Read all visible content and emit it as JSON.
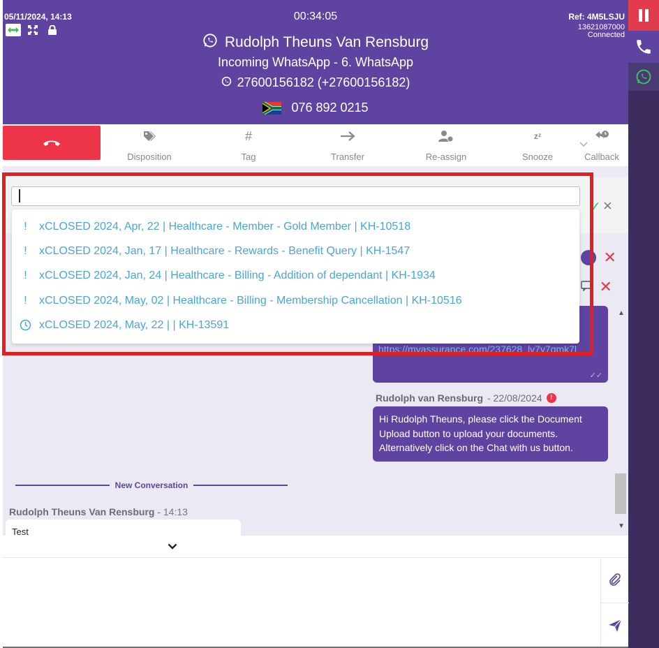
{
  "header": {
    "datetime": "05/11/2024, 14:13",
    "timer": "00:34:05",
    "ref": "Ref: 4M5LSJU",
    "ref_number": "13621087000",
    "status": "Connected",
    "contact_name": "Rudolph Theuns Van Rensburg",
    "incoming": "Incoming WhatsApp - 6. WhatsApp",
    "whatsapp_number": "27600156182 (+27600156182)",
    "phone": "076 892 0215"
  },
  "toolbar": {
    "disposition": "Disposition",
    "tag": "Tag",
    "transfer": "Transfer",
    "reassign": "Re-assign",
    "snooze": "Snooze",
    "callback": "Callback"
  },
  "search": {
    "value": "",
    "items": [
      {
        "icon": "exclamation-icon",
        "label": "xCLOSED 2024, Apr, 22 | Healthcare - Member - Gold Member | KH-10518"
      },
      {
        "icon": "exclamation-icon",
        "label": "xCLOSED 2024, Jan, 17 | Healthcare - Rewards - Benefit Query | KH-1547"
      },
      {
        "icon": "exclamation-icon",
        "label": "xCLOSED 2024, Jan, 24 | Healthcare - Billing - Addition of dependant | KH-1934"
      },
      {
        "icon": "exclamation-icon",
        "label": "xCLOSED 2024, May, 02 | Healthcare - Billing - Membership Cancellation | KH-10516"
      },
      {
        "icon": "clock-icon",
        "label": "xCLOSED 2024, May, 22 | | KH-13591"
      }
    ]
  },
  "chat": {
    "msg1_link": "https://myassurance.com/237628_lv7y7gmk7l",
    "msg2_sender": "Rudolph van Rensburg",
    "msg2_date": "- 22/08/2024",
    "msg2_text": "Hi Rudolph Theuns, please click the Document Upload button to upload your documents. Alternatively click on the Chat with us button.",
    "new_conversation": "New Conversation",
    "msg3_sender": "Rudolph Theuns Van Rensburg",
    "msg3_time": "- 14:13",
    "msg3_text": "Test"
  },
  "colors": {
    "primary": "#5f43a0",
    "danger": "#ee3448",
    "link": "#4aa5d8"
  }
}
